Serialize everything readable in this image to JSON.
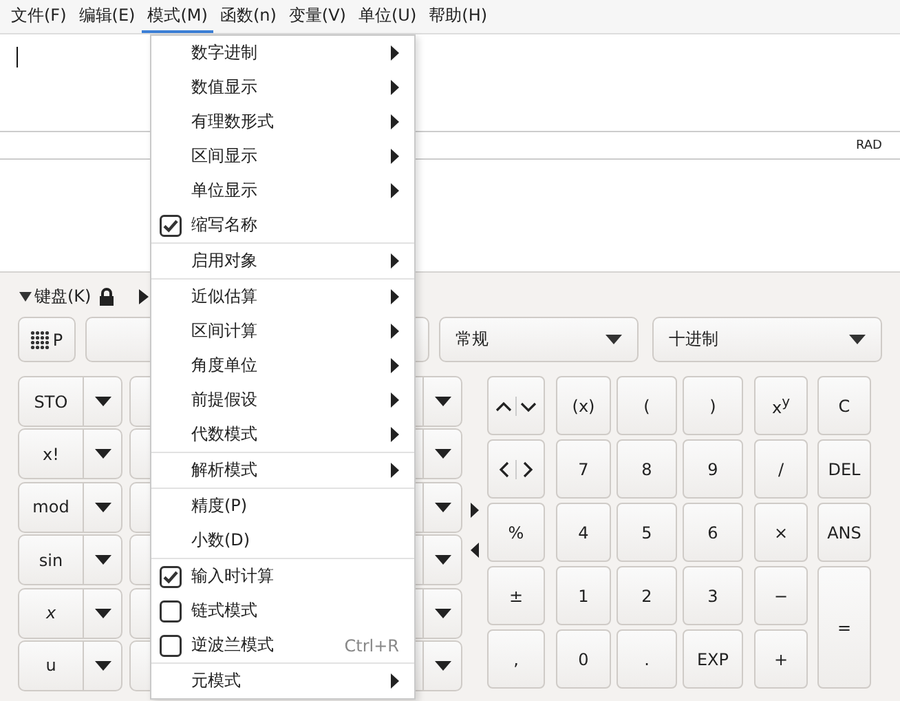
{
  "menubar": [
    {
      "label": "文件(F)",
      "selected": false
    },
    {
      "label": "编辑(E)",
      "selected": false
    },
    {
      "label": "模式(M)",
      "selected": true
    },
    {
      "label": "函数(n)",
      "selected": false
    },
    {
      "label": "变量(V)",
      "selected": false
    },
    {
      "label": "单位(U)",
      "selected": false
    },
    {
      "label": "帮助(H)",
      "selected": false
    }
  ],
  "status_bar": {
    "angle_unit": "RAD"
  },
  "keypad": {
    "title": "键盘(K)",
    "grid_button": "P",
    "dropdowns": [
      {
        "value": "常规"
      },
      {
        "value": "十进制"
      }
    ],
    "function_buttons": [
      {
        "label": "STO",
        "italic": false
      },
      {
        "label": "x!",
        "italic": false
      },
      {
        "label": "mod",
        "italic": false
      },
      {
        "label": "sin",
        "italic": false
      },
      {
        "label": "x",
        "italic": true
      },
      {
        "label": "u",
        "italic": false
      }
    ],
    "keys": [
      {
        "kind": "updown"
      },
      {
        "kind": "text",
        "label": "(x)"
      },
      {
        "kind": "text",
        "label": "("
      },
      {
        "kind": "text",
        "label": ")"
      },
      {
        "kind": "text",
        "label": "x$^{y}$"
      },
      {
        "kind": "text",
        "label": "C"
      },
      {
        "kind": "leftright"
      },
      {
        "kind": "text",
        "label": "7"
      },
      {
        "kind": "text",
        "label": "8"
      },
      {
        "kind": "text",
        "label": "9"
      },
      {
        "kind": "text",
        "label": "/"
      },
      {
        "kind": "text",
        "label": "DEL"
      },
      {
        "kind": "text",
        "label": "%"
      },
      {
        "kind": "text",
        "label": "4"
      },
      {
        "kind": "text",
        "label": "5"
      },
      {
        "kind": "text",
        "label": "6"
      },
      {
        "kind": "text",
        "label": "×"
      },
      {
        "kind": "text",
        "label": "ANS"
      },
      {
        "kind": "text",
        "label": "±"
      },
      {
        "kind": "text",
        "label": "1"
      },
      {
        "kind": "text",
        "label": "2"
      },
      {
        "kind": "text",
        "label": "3"
      },
      {
        "kind": "text",
        "label": "−"
      },
      {
        "kind": "tall",
        "label": "="
      },
      {
        "kind": "text",
        "label": ","
      },
      {
        "kind": "text",
        "label": "0"
      },
      {
        "kind": "text",
        "label": "."
      },
      {
        "kind": "text",
        "label": "EXP"
      },
      {
        "kind": "text",
        "label": "+"
      }
    ]
  },
  "menu": [
    {
      "label": "数字进制",
      "kind": "submenu",
      "separator_before": false
    },
    {
      "label": "数值显示",
      "kind": "submenu",
      "separator_before": false
    },
    {
      "label": "有理数形式",
      "kind": "submenu",
      "separator_before": false
    },
    {
      "label": "区间显示",
      "kind": "submenu",
      "separator_before": false
    },
    {
      "label": "单位显示",
      "kind": "submenu",
      "separator_before": false
    },
    {
      "label": "缩写名称",
      "kind": "check",
      "checked": true,
      "separator_before": false
    },
    {
      "label": "启用对象",
      "kind": "submenu",
      "separator_before": true
    },
    {
      "label": "近似估算",
      "kind": "submenu",
      "separator_before": true
    },
    {
      "label": "区间计算",
      "kind": "submenu",
      "separator_before": false
    },
    {
      "label": "角度单位",
      "kind": "submenu",
      "separator_before": false
    },
    {
      "label": "前提假设",
      "kind": "submenu",
      "separator_before": false
    },
    {
      "label": "代数模式",
      "kind": "submenu",
      "separator_before": false
    },
    {
      "label": "解析模式",
      "kind": "submenu",
      "separator_before": true
    },
    {
      "label": "精度(P)",
      "kind": "plain",
      "separator_before": true
    },
    {
      "label": "小数(D)",
      "kind": "plain",
      "separator_before": false
    },
    {
      "label": "输入时计算",
      "kind": "check",
      "checked": true,
      "separator_before": true
    },
    {
      "label": "链式模式",
      "kind": "check",
      "checked": false,
      "separator_before": false
    },
    {
      "label": "逆波兰模式",
      "kind": "check",
      "checked": false,
      "shortcut": "Ctrl+R",
      "separator_before": false
    },
    {
      "label": "元模式",
      "kind": "submenu",
      "separator_before": true
    }
  ]
}
